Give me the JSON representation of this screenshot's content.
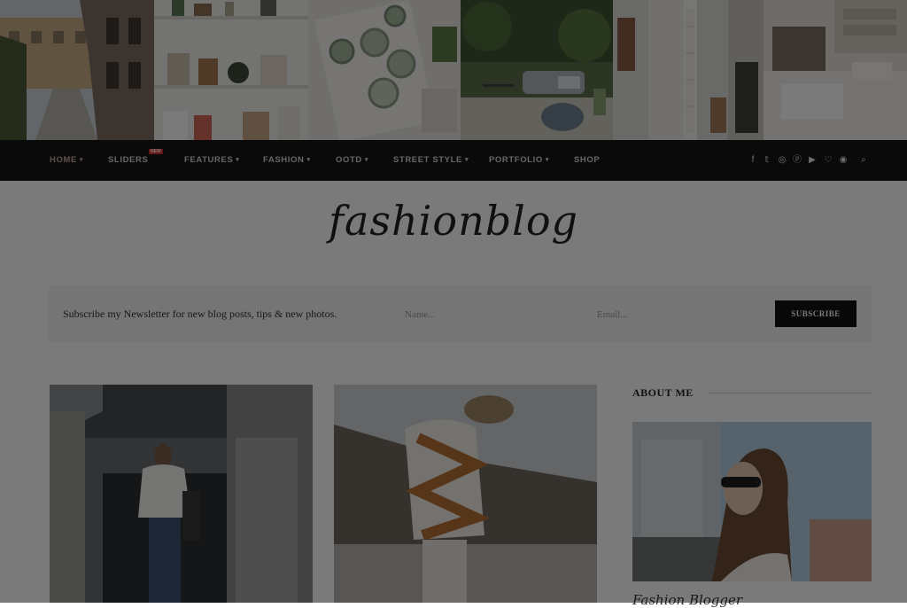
{
  "nav": {
    "items": [
      {
        "label": "HOME",
        "caret": "▾"
      },
      {
        "label": "SLIDERS",
        "badge": "NEW"
      },
      {
        "label": "FEATURES",
        "caret": "▾"
      },
      {
        "label": "FASHION",
        "caret": "▾"
      },
      {
        "label": "OOTD",
        "caret": "▾"
      },
      {
        "label": "STREET STYLE",
        "caret": "▾"
      },
      {
        "label": "PORTFOLIO",
        "caret": "▾"
      },
      {
        "label": "SHOP"
      }
    ],
    "social_icons": [
      "facebook-icon",
      "twitter-icon",
      "instagram-icon",
      "pinterest-icon",
      "youtube-icon",
      "heart-icon",
      "snapchat-icon",
      "search-icon"
    ],
    "social_glyphs": [
      "f",
      "𝕥",
      "◎",
      "ⓟ",
      "▶",
      "♡",
      "◉",
      "⌕"
    ]
  },
  "logo": {
    "text": "fashionblog"
  },
  "newsletter": {
    "text": "Subscribe my Newsletter for new blog posts, tips & new photos.",
    "name_placeholder": "Name...",
    "email_placeholder": "Email...",
    "button": "SUBSCRIBE"
  },
  "sidebar": {
    "about_title": "ABOUT ME",
    "about_name": "Fashion Blogger"
  },
  "colors": {
    "nav_bg": "#151515",
    "nav_active": "#c9a8a0",
    "accent_badge": "#dd3333",
    "button_bg": "#111111",
    "overlay": "rgba(0,0,0,0.52)"
  }
}
